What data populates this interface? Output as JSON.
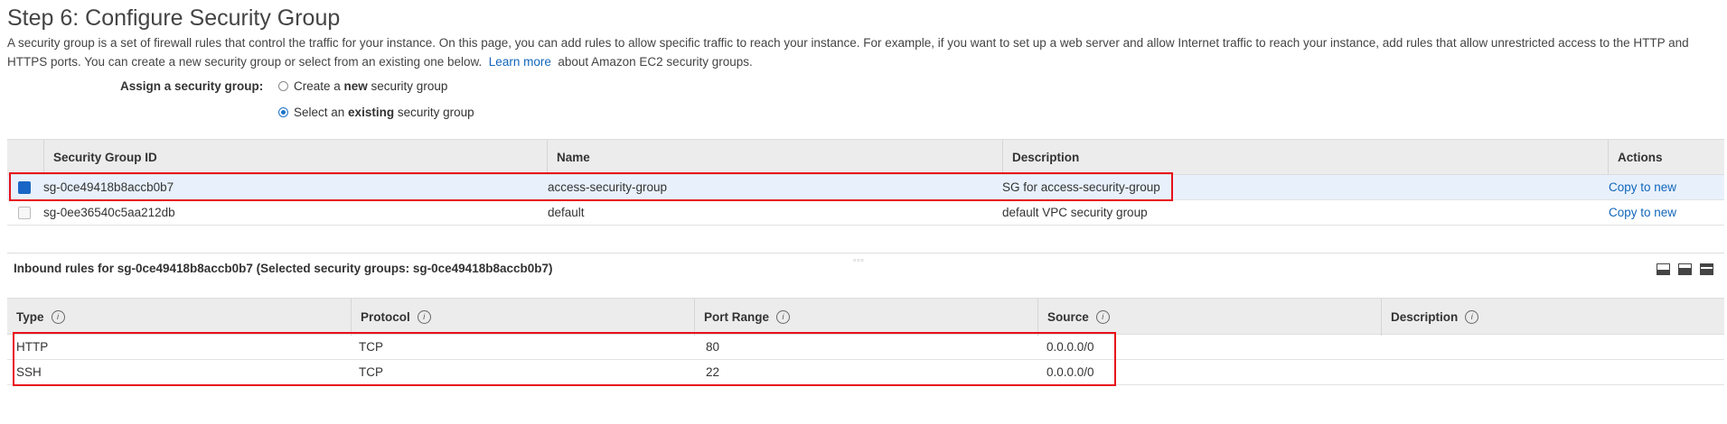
{
  "page": {
    "title": "Step 6: Configure Security Group",
    "desc_before_link": "A security group is a set of firewall rules that control the traffic for your instance. On this page, you can add rules to allow specific traffic to reach your instance. For example, if you want to set up a web server and allow Internet traffic to reach your instance, add rules that allow unrestricted access to the HTTP and HTTPS ports. You can create a new security group or select from an existing one below.",
    "learn_more": "Learn more",
    "desc_after_link": "about Amazon EC2 security groups."
  },
  "assign": {
    "label": "Assign a security group:",
    "option_new_pre": "Create a ",
    "option_new_bold": "new",
    "option_new_post": " security group",
    "option_existing_pre": "Select an ",
    "option_existing_bold": "existing",
    "option_existing_post": " security group",
    "selected": "existing"
  },
  "sg_table": {
    "headers": {
      "id": "Security Group ID",
      "name": "Name",
      "description": "Description",
      "actions": "Actions"
    },
    "rows": [
      {
        "id": "sg-0ce49418b8accb0b7",
        "name": "access-security-group",
        "description": "SG for access-security-group",
        "action": "Copy to new",
        "selected": true
      },
      {
        "id": "sg-0ee36540c5aa212db",
        "name": "default",
        "description": "default VPC security group",
        "action": "Copy to new",
        "selected": false
      }
    ]
  },
  "inbound": {
    "title": "Inbound rules for sg-0ce49418b8accb0b7 (Selected security groups: sg-0ce49418b8accb0b7)",
    "headers": {
      "type": "Type",
      "protocol": "Protocol",
      "port_range": "Port Range",
      "source": "Source",
      "description": "Description"
    },
    "info_glyph": "i",
    "rows": [
      {
        "type": "HTTP",
        "protocol": "TCP",
        "port_range": "80",
        "source": "0.0.0.0/0",
        "description": ""
      },
      {
        "type": "SSH",
        "protocol": "TCP",
        "port_range": "22",
        "source": "0.0.0.0/0",
        "description": ""
      }
    ]
  },
  "colors": {
    "highlight": "#e8101a",
    "link": "#1166bb",
    "selected_row": "#e8f1fb",
    "header_bg": "#ececec"
  }
}
